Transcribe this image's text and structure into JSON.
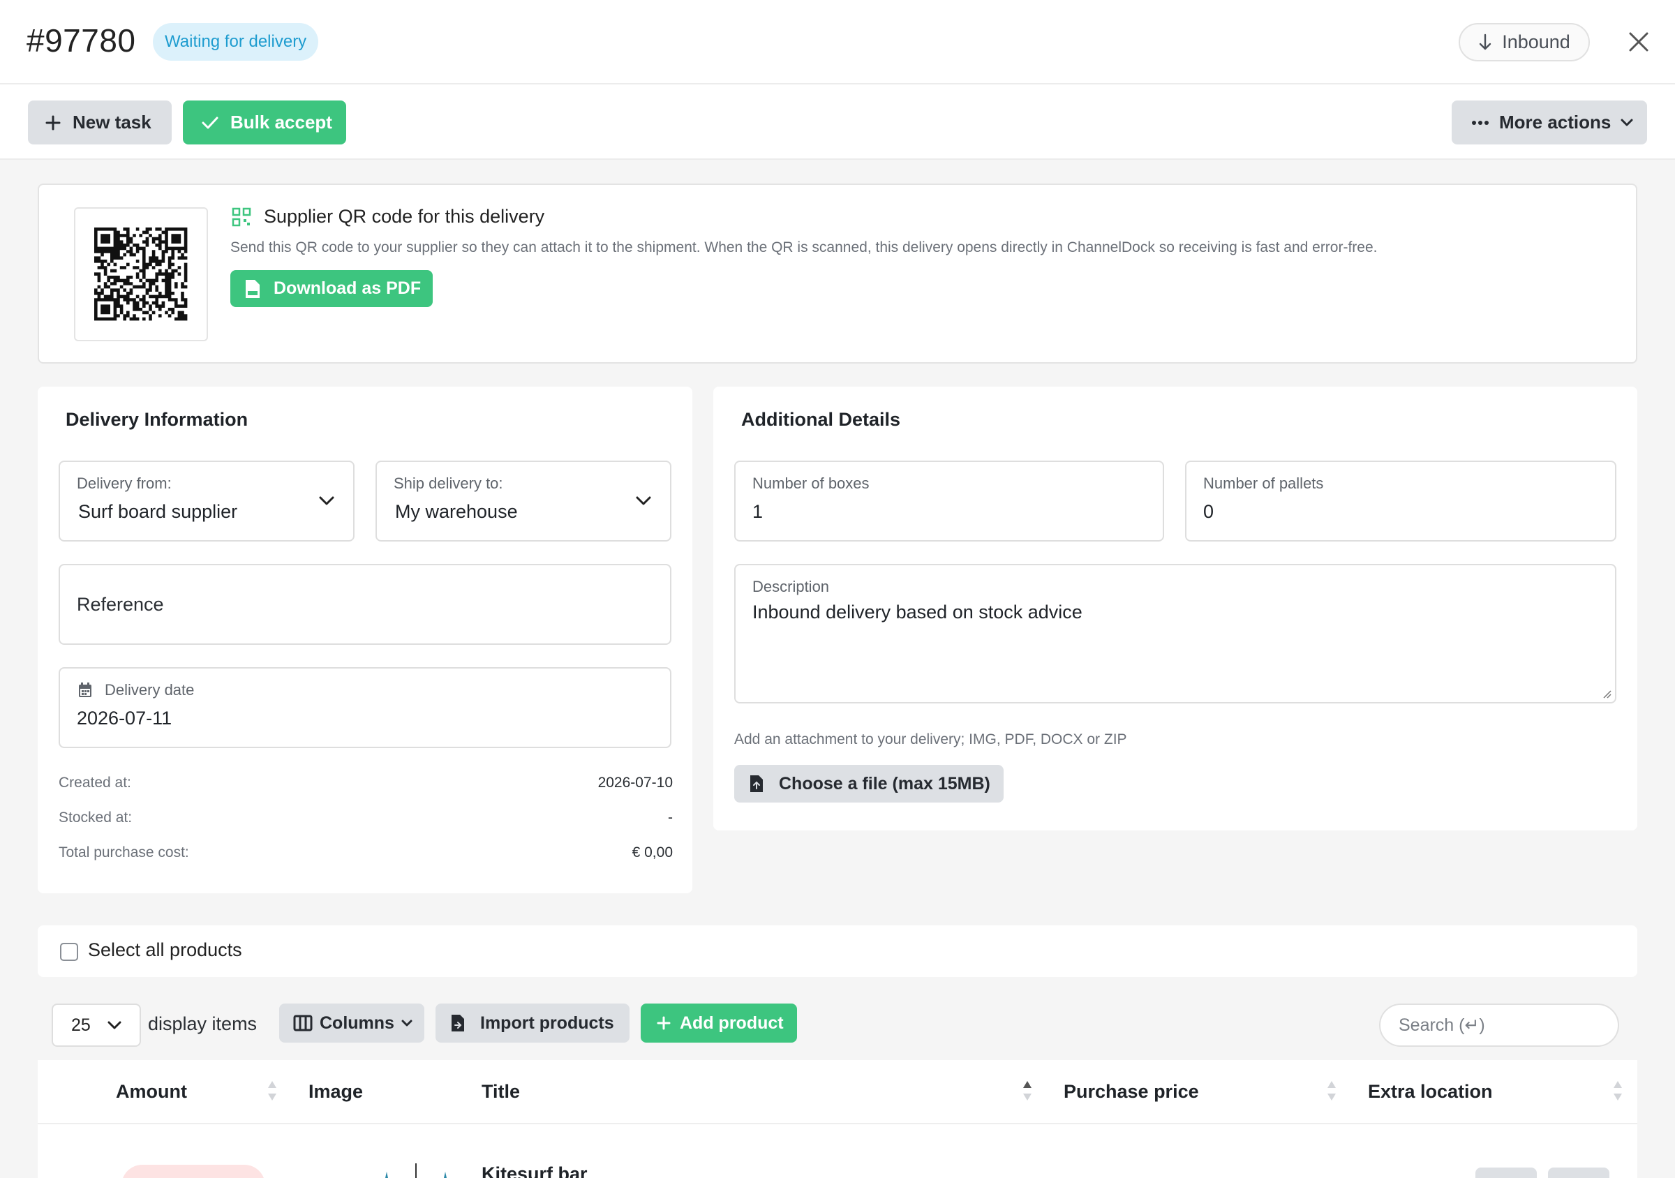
{
  "header": {
    "delivery_id": "#97780",
    "status": "Waiting for delivery",
    "direction": "Inbound"
  },
  "toolbar": {
    "new_task": "New task",
    "bulk_accept": "Bulk accept",
    "more_actions": "More actions"
  },
  "qr": {
    "title": "Supplier QR code for this delivery",
    "description": "Send this QR code to your supplier so they can attach it to the shipment. When the QR is scanned, this delivery opens directly in ChannelDock so receiving is fast and error-free.",
    "download": "Download as PDF"
  },
  "delivery_info": {
    "title": "Delivery Information",
    "from_label": "Delivery from:",
    "from_value": "Surf board supplier",
    "to_label": "Ship delivery to:",
    "to_value": "My warehouse",
    "reference_label": "Reference",
    "date_label": "Delivery date",
    "date_value": "2026-07-11",
    "created_label": "Created at:",
    "created_value": "2026-07-10",
    "stocked_label": "Stocked at:",
    "stocked_value": "-",
    "cost_label": "Total purchase cost:",
    "cost_value": "€ 0,00"
  },
  "additional": {
    "title": "Additional Details",
    "boxes_label": "Number of boxes",
    "boxes_value": "1",
    "pallets_label": "Number of pallets",
    "pallets_value": "0",
    "description_label": "Description",
    "description_value": "Inbound delivery based on stock advice",
    "attach_hint": "Add an attachment to your delivery; IMG, PDF, DOCX or ZIP",
    "choose_file": "Choose a file (max 15MB)"
  },
  "products": {
    "select_all": "Select all products",
    "per_page": "25",
    "display_items": "display items",
    "columns": "Columns",
    "import": "Import products",
    "add": "Add product",
    "search_placeholder": "Search (↵)",
    "columns_headers": [
      "Amount",
      "Image",
      "Title",
      "Purchase price",
      "Extra location"
    ],
    "rows": [
      {
        "title": "Kitesurf bar"
      }
    ]
  },
  "colors": {
    "accent_green": "#3dc57f",
    "status_blue": "#1e9ccf",
    "status_bg": "#dcf1fb"
  }
}
